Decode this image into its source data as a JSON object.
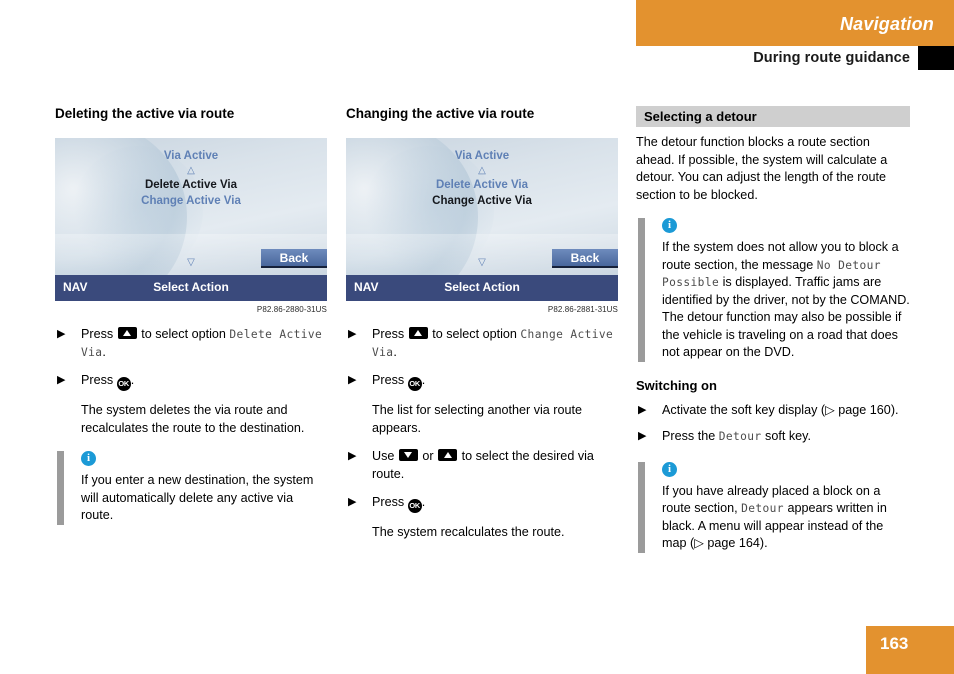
{
  "header": {
    "chapter": "Navigation",
    "section": "During route guidance"
  },
  "footer": {
    "page_number": "163"
  },
  "colors": {
    "accent_orange": "#e3922f",
    "info_blue": "#1c9ad6",
    "note_bar_grey": "#9b9b9b",
    "subhead_band_grey": "#cfcfcf",
    "screen_bottom_blue": "#3a4a7c",
    "screen_text_blue": "#5f80b5"
  },
  "left_column": {
    "title": "Deleting the active via route",
    "screen": {
      "title": "Via Active",
      "arrow_up": "△",
      "arrow_down": "▽",
      "items": [
        {
          "label": "Delete Active Via",
          "selected": true
        },
        {
          "label": "Change Active Via",
          "selected": false
        }
      ],
      "back_button": "Back",
      "status_left": "NAV",
      "status_center": "Select Action"
    },
    "caption": "P82.86-2880-31US",
    "steps": [
      {
        "bullet": "▶",
        "text_before": "Press",
        "key": "up",
        "text_mid": "to select option",
        "mono": "Delete Active Via",
        "text_after": "."
      },
      {
        "bullet": "▶",
        "text_before": "Press",
        "key": "ok",
        "key_label": "OK",
        "text_after": "."
      }
    ],
    "result_text": "The system deletes the via route and recalculates the route to the destination.",
    "note": {
      "icon": "info-icon",
      "icon_glyph": "i",
      "text": "If you enter a new destination, the system will automatically delete any active via route."
    }
  },
  "middle_column": {
    "title": "Changing the active via route",
    "screen": {
      "title": "Via Active",
      "arrow_up": "△",
      "arrow_down": "▽",
      "items": [
        {
          "label": "Delete Active Via",
          "selected": false
        },
        {
          "label": "Change Active Via",
          "selected": true
        }
      ],
      "back_button": "Back",
      "status_left": "NAV",
      "status_center": "Select Action"
    },
    "caption": "P82.86-2881-31US",
    "steps": [
      {
        "bullet": "▶",
        "text_before": "Press",
        "key": "up",
        "text_mid": "to select option",
        "mono": "Change Active Via",
        "text_after": "."
      },
      {
        "bullet": "▶",
        "text_before": "Press",
        "key": "ok",
        "key_label": "OK",
        "text_after": "."
      }
    ],
    "result_text_1": "The list for selecting another via route appears.",
    "step_use": {
      "bullet": "▶",
      "text_before": "Use",
      "key_1": "down",
      "text_or": "or",
      "key_2": "up",
      "text_after": "to select the desired via route."
    },
    "step_press_ok": {
      "bullet": "▶",
      "text_before": "Press",
      "key_label": "OK",
      "text_after": "."
    },
    "result_text_2": "The system recalculates the route."
  },
  "right_column": {
    "subhead_banner": "Selecting a detour",
    "intro": "The detour function blocks a route section ahead. If possible, the system will calculate a detour. You can adjust the length of the route section to be blocked.",
    "note_1": {
      "icon_glyph": "i",
      "part_1": "If the system does not allow you to block a route section, the message",
      "mono_1": "No Detour Possible",
      "part_2": "is displayed. Traffic jams are identified by the driver, not by the COMAND. The detour function may also be possible if the vehicle is traveling on a road that does not appear on the DVD."
    },
    "switching_on_head": "Switching on",
    "steps": [
      {
        "bullet": "▶",
        "text_before": "Activate the soft key display (",
        "ref_arrow": "▷",
        "ref_text": "page 160",
        "text_after": ")."
      },
      {
        "bullet": "▶",
        "text_before": "Press the",
        "mono": "Detour",
        "text_after": "soft key."
      }
    ],
    "note_2": {
      "icon_glyph": "i",
      "part_1": "If you have already placed a block on a route section,",
      "mono_1": "Detour",
      "part_2": "appears written in black. A menu will appear instead of the map (",
      "ref_arrow": "▷",
      "ref_text": "page 164",
      "part_3": ")."
    }
  }
}
